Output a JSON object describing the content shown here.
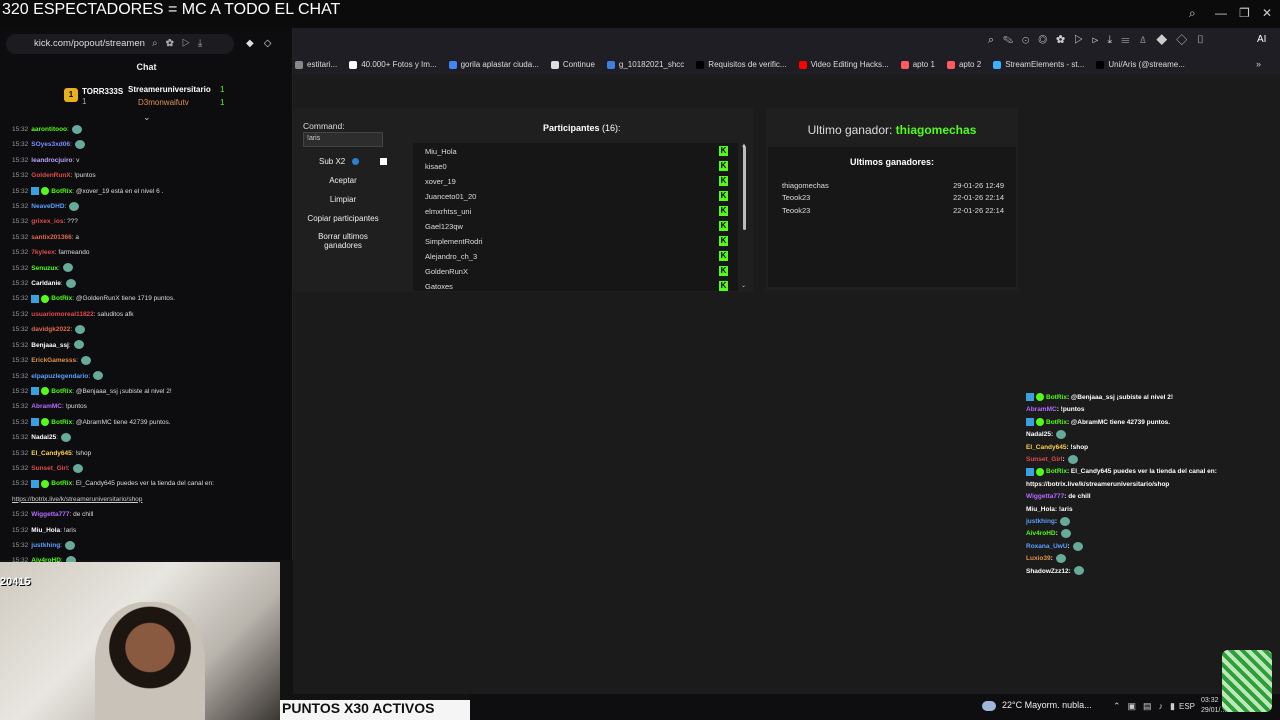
{
  "stream": {
    "title": "320 ESPECTADORES = MC A TODO EL CHAT",
    "bottom_banner": "PUNTOS X30 ACTIVOS",
    "cam_counter": "20415"
  },
  "left_browser": {
    "url": "kick.com/popout/streamen",
    "chat_title": "Chat",
    "pinned": {
      "user1": "TORR333S",
      "user1_count": "1",
      "user2": "Streameruniversitario",
      "user2_count": "1",
      "user3": "D3monwaifutv",
      "user3_count": "1"
    },
    "messages": [
      {
        "time": "15:32",
        "user": "aarontitooo",
        "text": ":",
        "color": "#53fc18"
      },
      {
        "time": "15:32",
        "user": "SOyes3xd06",
        "text": ":",
        "color": "#7c8cff"
      },
      {
        "time": "15:32",
        "user": "leandrocjuiro",
        "text": ": v",
        "color": "#b9a5ff"
      },
      {
        "time": "15:32",
        "user": "GoldenRunX",
        "text": ": !puntos",
        "color": "#e14b4b"
      },
      {
        "time": "15:32",
        "user": "BotRix",
        "text": ": @xover_19 está en el nivel 6 .",
        "color": "#53fc18"
      },
      {
        "time": "15:32",
        "user": "NeaveDHD",
        "text": ":",
        "color": "#5aa0ff"
      },
      {
        "time": "15:32",
        "user": "grixex_ios",
        "text": ": ???",
        "color": "#e14b4b"
      },
      {
        "time": "15:32",
        "user": "santix201366",
        "text": ": a",
        "color": "#e06a4b"
      },
      {
        "time": "15:32",
        "user": "7kyleex",
        "text": ": farmeando",
        "color": "#e14b4b"
      },
      {
        "time": "15:32",
        "user": "Senuzux",
        "text": ":",
        "color": "#53fc18"
      },
      {
        "time": "15:32",
        "user": "Carldanie",
        "text": ":",
        "color": "#ffffff"
      },
      {
        "time": "15:32",
        "user": "BotRix",
        "text": ": @GoldenRunX tiene 1719 puntos.",
        "color": "#53fc18"
      },
      {
        "time": "15:32",
        "user": "usuariomoreal11822",
        "text": ": saluditos afk",
        "color": "#e14b4b"
      },
      {
        "time": "15:32",
        "user": "davidgk2022",
        "text": ":",
        "color": "#e06a4b"
      },
      {
        "time": "15:32",
        "user": "Benjaaa_ssj",
        "text": ":",
        "color": "#ffffff"
      },
      {
        "time": "15:32",
        "user": "ErickGamesss",
        "text": ":",
        "color": "#e0904b"
      },
      {
        "time": "15:32",
        "user": "elpapuzlegendario",
        "text": ":",
        "color": "#5aa0ff"
      },
      {
        "time": "15:32",
        "user": "BotRix",
        "text": ": @Benjaaa_ssj ¡subiste al nivel 2!",
        "color": "#53fc18"
      },
      {
        "time": "15:32",
        "user": "AbramMC",
        "text": ": !puntos",
        "color": "#b46bff"
      },
      {
        "time": "15:32",
        "user": "BotRix",
        "text": ": @AbramMC tiene 42739 puntos.",
        "color": "#53fc18"
      },
      {
        "time": "15:32",
        "user": "Nadal25",
        "text": ":",
        "color": "#ffffff"
      },
      {
        "time": "15:32",
        "user": "El_Candy645",
        "text": ": !shop",
        "color": "#ffd24b"
      },
      {
        "time": "15:32",
        "user": "Sunset_Girl",
        "text": ":",
        "color": "#e14b4b"
      },
      {
        "time": "15:32",
        "user": "BotRix",
        "text": ": El_Candy645 puedes ver la tienda del canal en:",
        "color": "#53fc18"
      },
      {
        "time": "",
        "user": "",
        "text": "https://botrix.live/k/streameruniversitario/shop",
        "color": "#ffffff"
      },
      {
        "time": "15:32",
        "user": "Wiggetta777",
        "text": ": de chill",
        "color": "#b46bff"
      },
      {
        "time": "15:32",
        "user": "Miu_Hola",
        "text": ": !aris",
        "color": "#ffffff"
      },
      {
        "time": "15:32",
        "user": "justkhing",
        "text": ":",
        "color": "#5aa0ff"
      },
      {
        "time": "15:32",
        "user": "Aiv4roHD",
        "text": ":",
        "color": "#53fc18"
      }
    ]
  },
  "right_browser": {
    "bookmarks": [
      {
        "label": "estitari...",
        "color": "#888888"
      },
      {
        "label": "40.000+ Fotos y Im...",
        "color": "#ffffff"
      },
      {
        "label": "gorila aplastar ciuda...",
        "color": "#4285f4"
      },
      {
        "label": "Continue",
        "color": "#dddddd"
      },
      {
        "label": "g_10182021_shcc",
        "color": "#3f7fe0"
      },
      {
        "label": "Requisitos de verific...",
        "color": "#000000"
      },
      {
        "label": "Video Editing Hacks...",
        "color": "#ff0000"
      },
      {
        "label": "apto 1",
        "color": "#ff5a5f"
      },
      {
        "label": "apto 2",
        "color": "#ff5a5f"
      },
      {
        "label": "StreamElements - st...",
        "color": "#3ab0ff"
      },
      {
        "label": "Uni/Aris (@streame...",
        "color": "#000000"
      }
    ]
  },
  "giveaway": {
    "command_label": "Command:",
    "command_value": "!aris",
    "sub_label": "Sub X2",
    "buttons": {
      "accept": "Aceptar",
      "clear": "Limpiar",
      "copy": "Copiar participantes",
      "delete": "Borrar ultimos ganadores"
    },
    "participants_label": "Participantes",
    "participants_count": "(16):",
    "participants": [
      "Miu_Hola",
      "kisae0",
      "xover_19",
      "Juanceto01_20",
      "elmxrhtss_uni",
      "Gael123qw",
      "SimplementRodri",
      "Alejandro_ch_3",
      "GoldenRunX",
      "Gatoxes"
    ],
    "winner_label": "Ultimo ganador:",
    "winner_name": "thiagomechas",
    "last_winners_title": "Ultimos ganadores:",
    "last_winners": [
      {
        "name": "thiagomechas",
        "date": "29-01-26 12:49"
      },
      {
        "name": "Teook23",
        "date": "22-01-26 22:14"
      },
      {
        "name": "Teook23",
        "date": "22-01-26 22:14"
      }
    ]
  },
  "overlay_chat": [
    {
      "user": "BotRix",
      "text": ": @Benjaaa_ssj ¡subiste al nivel 2!",
      "color": "#53fc18"
    },
    {
      "user": "AbramMC",
      "text": ": !puntos",
      "color": "#b46bff"
    },
    {
      "user": "BotRix",
      "text": ": @AbramMC tiene 42739 puntos.",
      "color": "#53fc18"
    },
    {
      "user": "Nadal25",
      "text": ":",
      "color": "#ffffff"
    },
    {
      "user": "El_Candy645",
      "text": ": !shop",
      "color": "#ffd24b"
    },
    {
      "user": "Sunset_Girl",
      "text": ":",
      "color": "#e14b4b"
    },
    {
      "user": "BotRix",
      "text": ": El_Candy645 puedes ver la tienda del canal en:",
      "color": "#53fc18"
    },
    {
      "user": "",
      "text": "https://botrix.live/k/streameruniversitario/shop",
      "color": "#ffffff"
    },
    {
      "user": "Wiggetta777",
      "text": ": de chill",
      "color": "#b46bff"
    },
    {
      "user": "Miu_Hola",
      "text": ": !aris",
      "color": "#ffffff"
    },
    {
      "user": "justkhing",
      "text": ":",
      "color": "#5aa0ff"
    },
    {
      "user": "Aiv4roHD",
      "text": ":",
      "color": "#53fc18"
    },
    {
      "user": "Roxana_UwU",
      "text": ":",
      "color": "#5aa0ff"
    },
    {
      "user": "Luxio39",
      "text": ":",
      "color": "#e0904b"
    },
    {
      "user": "ShadowZzz12",
      "text": ":",
      "color": "#ffffff"
    }
  ],
  "taskbar": {
    "weather": "22°C  Mayorm. nubla...",
    "lang": "ESP",
    "time": "03:32",
    "date": "29/01/..."
  },
  "colors": {
    "kick_green": "#53fc18",
    "bg": "#1b1b1b"
  }
}
